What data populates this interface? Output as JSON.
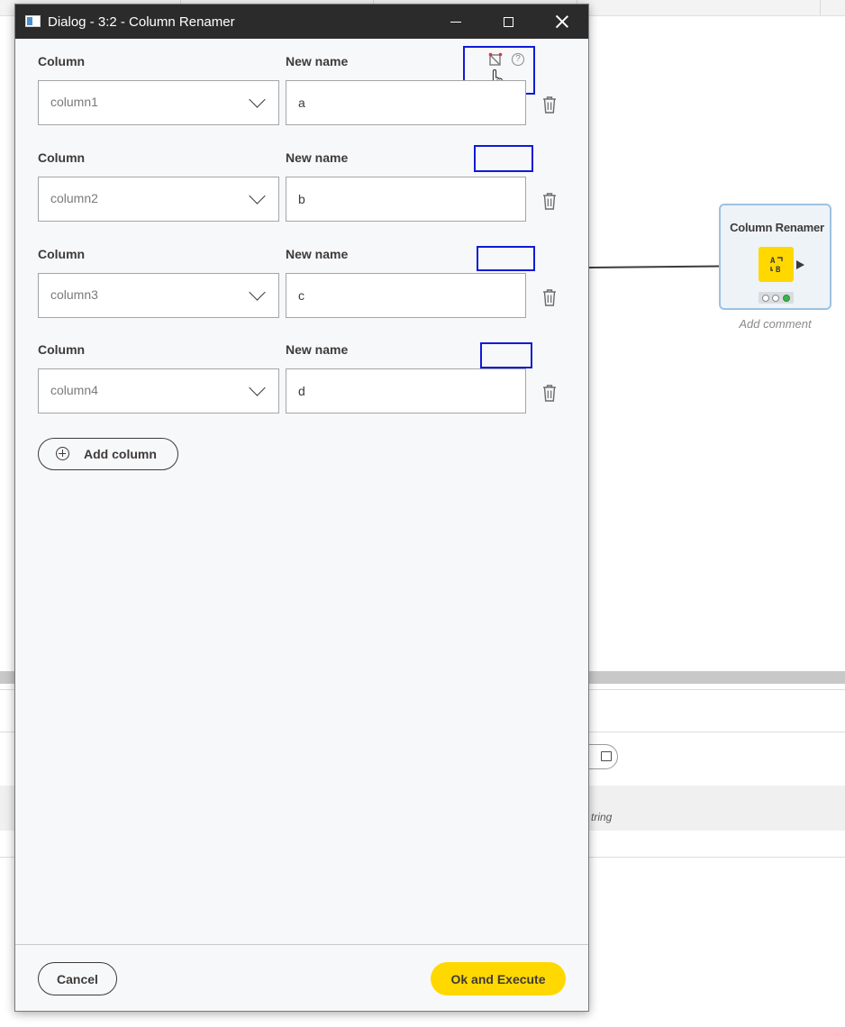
{
  "window": {
    "title": "Dialog - 3:2 - Column Renamer"
  },
  "labels": {
    "column": "Column",
    "new_name": "New name"
  },
  "rows": [
    {
      "column": "column1",
      "new_name": "a"
    },
    {
      "column": "column2",
      "new_name": "b"
    },
    {
      "column": "column3",
      "new_name": "c"
    },
    {
      "column": "column4",
      "new_name": "d"
    }
  ],
  "actions": {
    "add_column": "Add column",
    "cancel": "Cancel",
    "ok_execute": "Ok and Execute"
  },
  "header_icons": {
    "flow_variable": "flow-variable-icon",
    "help": "?"
  },
  "background": {
    "node_title": "Column Renamer",
    "node_icon_text": "A→B",
    "add_comment": "Add comment",
    "table_type": "tring"
  },
  "colors": {
    "accent": "#ffd800",
    "titlebar": "#2b2b2b",
    "highlight": "#0f1bd6"
  }
}
